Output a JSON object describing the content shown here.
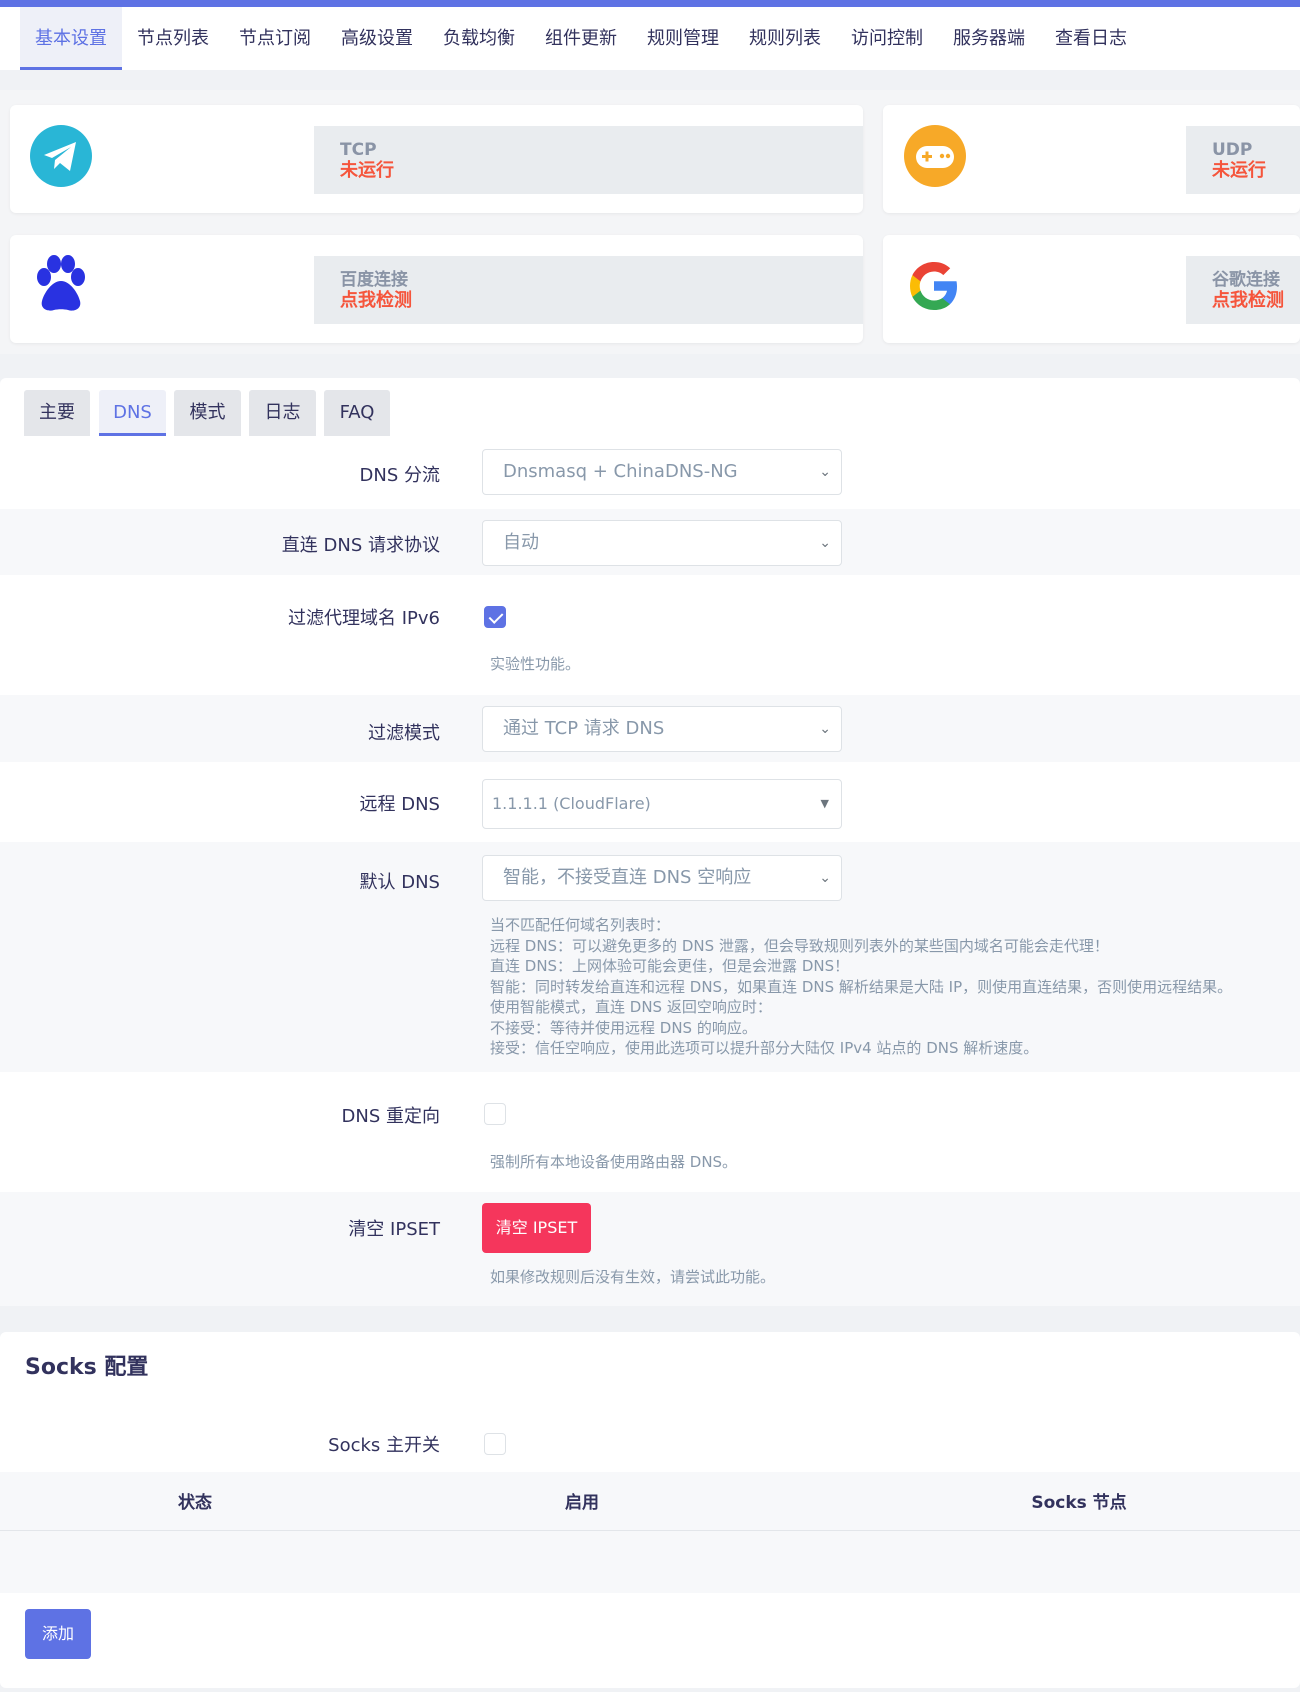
{
  "nav": {
    "tabs": [
      "基本设置",
      "节点列表",
      "节点订阅",
      "高级设置",
      "负载均衡",
      "组件更新",
      "规则管理",
      "规则列表",
      "访问控制",
      "服务器端",
      "查看日志"
    ],
    "active": 0
  },
  "status": {
    "tcp": {
      "title": "TCP",
      "value": "未运行",
      "icon": "telegram-icon"
    },
    "udp": {
      "title": "UDP",
      "value": "未运行",
      "icon": "gamepad-icon"
    },
    "baidu": {
      "title": "百度连接",
      "value": "点我检测",
      "icon": "baidu-paw-icon"
    },
    "google": {
      "title": "谷歌连接",
      "value": "点我检测",
      "icon": "google-icon"
    }
  },
  "subtabs": {
    "items": [
      "主要",
      "DNS",
      "模式",
      "日志",
      "FAQ"
    ],
    "active": 1
  },
  "dns": {
    "shunt": {
      "label": "DNS 分流",
      "value": "Dnsmasq + ChinaDNS-NG"
    },
    "direct_protocol": {
      "label": "直连 DNS 请求协议",
      "value": "自动"
    },
    "filter_ipv6": {
      "label": "过滤代理域名 IPv6",
      "checked": true,
      "desc": "实验性功能。"
    },
    "filter_mode": {
      "label": "过滤模式",
      "value": "通过 TCP 请求 DNS"
    },
    "remote_dns": {
      "label": "远程 DNS",
      "value": "1.1.1.1 (CloudFlare)"
    },
    "default_dns": {
      "label": "默认 DNS",
      "value": "智能，不接受直连 DNS 空响应",
      "desc": [
        "当不匹配任何域名列表时：",
        "远程 DNS：可以避免更多的 DNS 泄露，但会导致规则列表外的某些国内域名可能会走代理！",
        "直连 DNS：上网体验可能会更佳，但是会泄露 DNS！",
        "智能：同时转发给直连和远程 DNS，如果直连 DNS 解析结果是大陆 IP，则使用直连结果，否则使用远程结果。",
        "使用智能模式，直连 DNS 返回空响应时：",
        "不接受：等待并使用远程 DNS 的响应。",
        "接受：信任空响应，使用此选项可以提升部分大陆仅 IPv4 站点的 DNS 解析速度。"
      ]
    },
    "redirect": {
      "label": "DNS 重定向",
      "checked": false,
      "desc": "强制所有本地设备使用路由器 DNS。"
    },
    "clear_ipset": {
      "label": "清空 IPSET",
      "button": "清空 IPSET",
      "desc": "如果修改规则后没有生效，请尝试此功能。"
    }
  },
  "socks": {
    "title": "Socks 配置",
    "switch_label": "Socks 主开关",
    "checked": false,
    "columns": [
      "状态",
      "启用",
      "Socks 节点"
    ],
    "add_button": "添加"
  },
  "colors": {
    "accent": "#5e72e4",
    "danger": "#f5365c",
    "status_red": "#f5553c"
  }
}
